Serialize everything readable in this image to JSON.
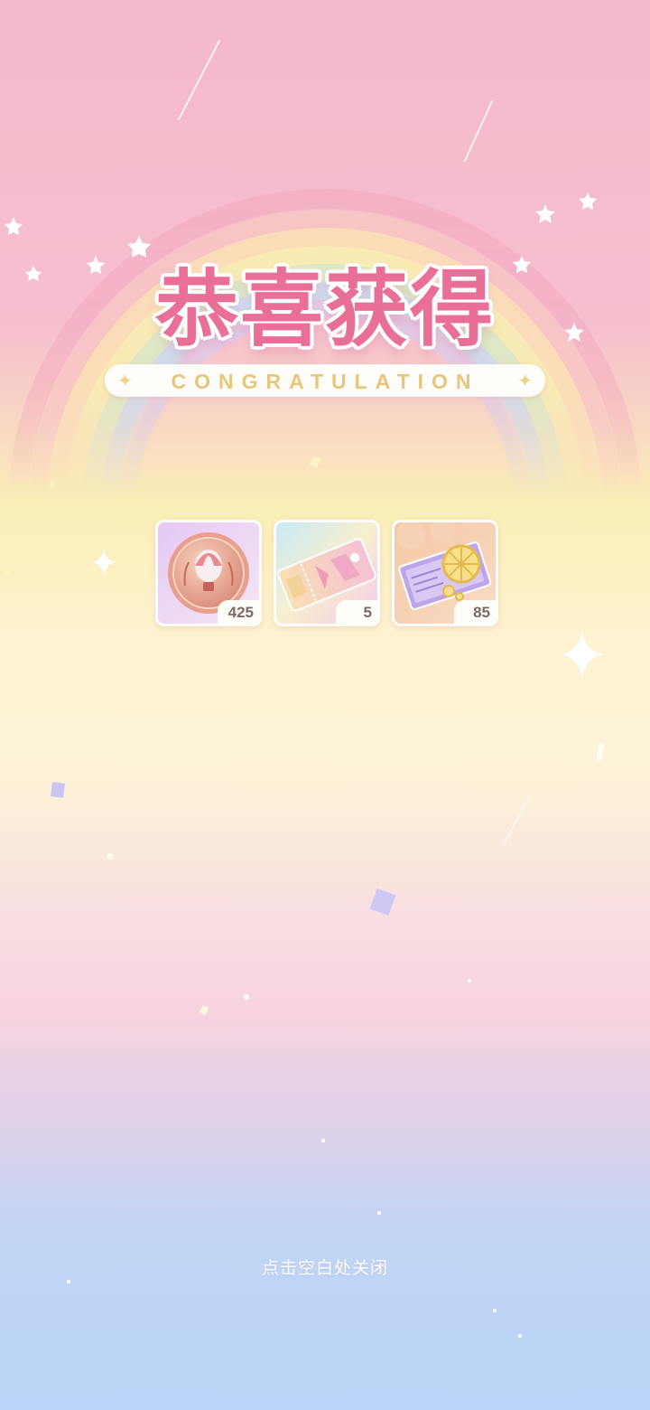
{
  "title": {
    "cn": "恭喜获得",
    "en": "CONGRATULATION"
  },
  "rewards": [
    {
      "name": "hot-air-balloon-medal",
      "count": "425"
    },
    {
      "name": "ticket-pass",
      "count": "5"
    },
    {
      "name": "lucky-wheel-ticket",
      "count": "85"
    }
  ],
  "close_hint": "点击空白处关闭",
  "colors": {
    "title_pink": "#ea6f96",
    "banner_gold": "#e7c67a"
  }
}
